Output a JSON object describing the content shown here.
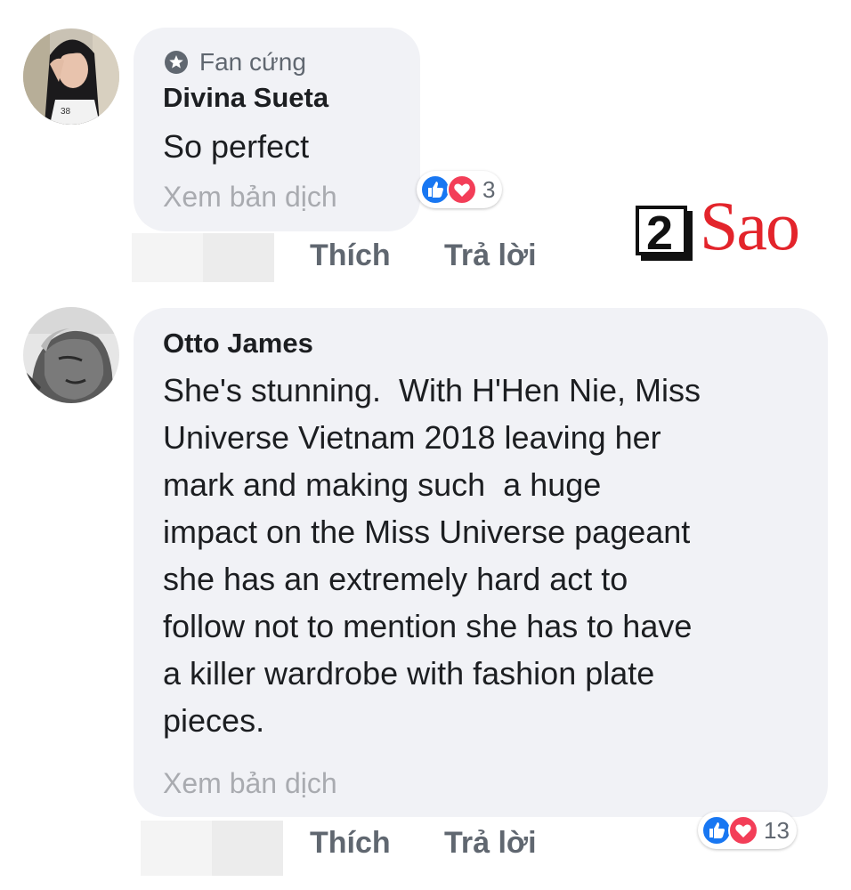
{
  "comments": [
    {
      "author": "Divina Sueta",
      "badge": "Fan cứng",
      "badge_icon": "star-badge-icon",
      "text": "So perfect",
      "see_translation": "Xem bản dịch",
      "reactions": [
        "like",
        "love"
      ],
      "reaction_count": "3",
      "actions": {
        "like": "Thích",
        "reply": "Trả lời"
      }
    },
    {
      "author": "Otto James",
      "text": "She's stunning.  With H'Hen Nie, Miss\nUniverse Vietnam 2018 leaving her\nmark and making such  a huge\nimpact on the Miss Universe pageant\nshe has an extremely hard act to\nfollow not to mention she has to have\na killer wardrobe with fashion plate\npieces.",
      "see_translation": "Xem bản dịch",
      "reactions": [
        "like",
        "love"
      ],
      "reaction_count": "13",
      "actions": {
        "like": "Thích",
        "reply": "Trả lời"
      }
    }
  ],
  "watermark": {
    "number": "2",
    "word": "Sao"
  },
  "colors": {
    "like_blue": "#1877f2",
    "love_red": "#f33e58",
    "bubble": "#f1f2f6",
    "brand_red": "#e3242b"
  }
}
